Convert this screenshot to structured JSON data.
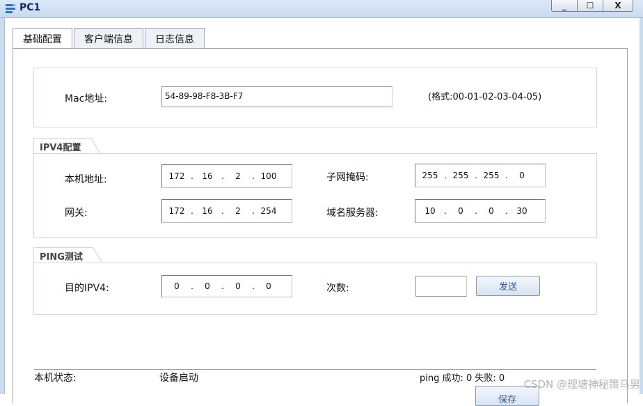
{
  "window": {
    "title": "PC1",
    "minimize_glyph": "_",
    "maximize_glyph": "☐",
    "close_glyph": "X"
  },
  "tabs": [
    {
      "label": "基础配置",
      "active": true
    },
    {
      "label": "客户端信息",
      "active": false
    },
    {
      "label": "日志信息",
      "active": false
    }
  ],
  "mac": {
    "label": "Mac地址:",
    "value": "54-89-98-F8-3B-F7",
    "format_hint": "(格式:00-01-02-03-04-05)"
  },
  "ipv4": {
    "group_title": "IPV4配置",
    "host_address": {
      "label": "本机地址:",
      "octets": [
        "172",
        "16",
        "2",
        "100"
      ]
    },
    "subnet_mask": {
      "label": "子网掩码:",
      "octets": [
        "255",
        "255",
        "255",
        "0"
      ]
    },
    "gateway": {
      "label": "网关:",
      "octets": [
        "172",
        "16",
        "2",
        "254"
      ]
    },
    "dns_server": {
      "label": "域名服务器:",
      "octets": [
        "10",
        "0",
        "0",
        "30"
      ]
    }
  },
  "ping": {
    "group_title": "PING测试",
    "dest_ipv4": {
      "label": "目的IPV4:",
      "octets": [
        "0",
        "0",
        "0",
        "0"
      ]
    },
    "count": {
      "label": "次数:",
      "value": ""
    },
    "send_button": "发送"
  },
  "status": {
    "label": "本机状态:",
    "value": "设备启动",
    "ping_result": "ping 成功: 0 失败: 0"
  },
  "footer": {
    "save_button": "保存"
  },
  "watermark": "CSDN @理塘神秘策马男",
  "colors": {
    "titlebar": "#c9dbf0",
    "title_text": "#0f2a67",
    "button_text": "#2d5a9a",
    "group_border": "#d3d7dc"
  }
}
